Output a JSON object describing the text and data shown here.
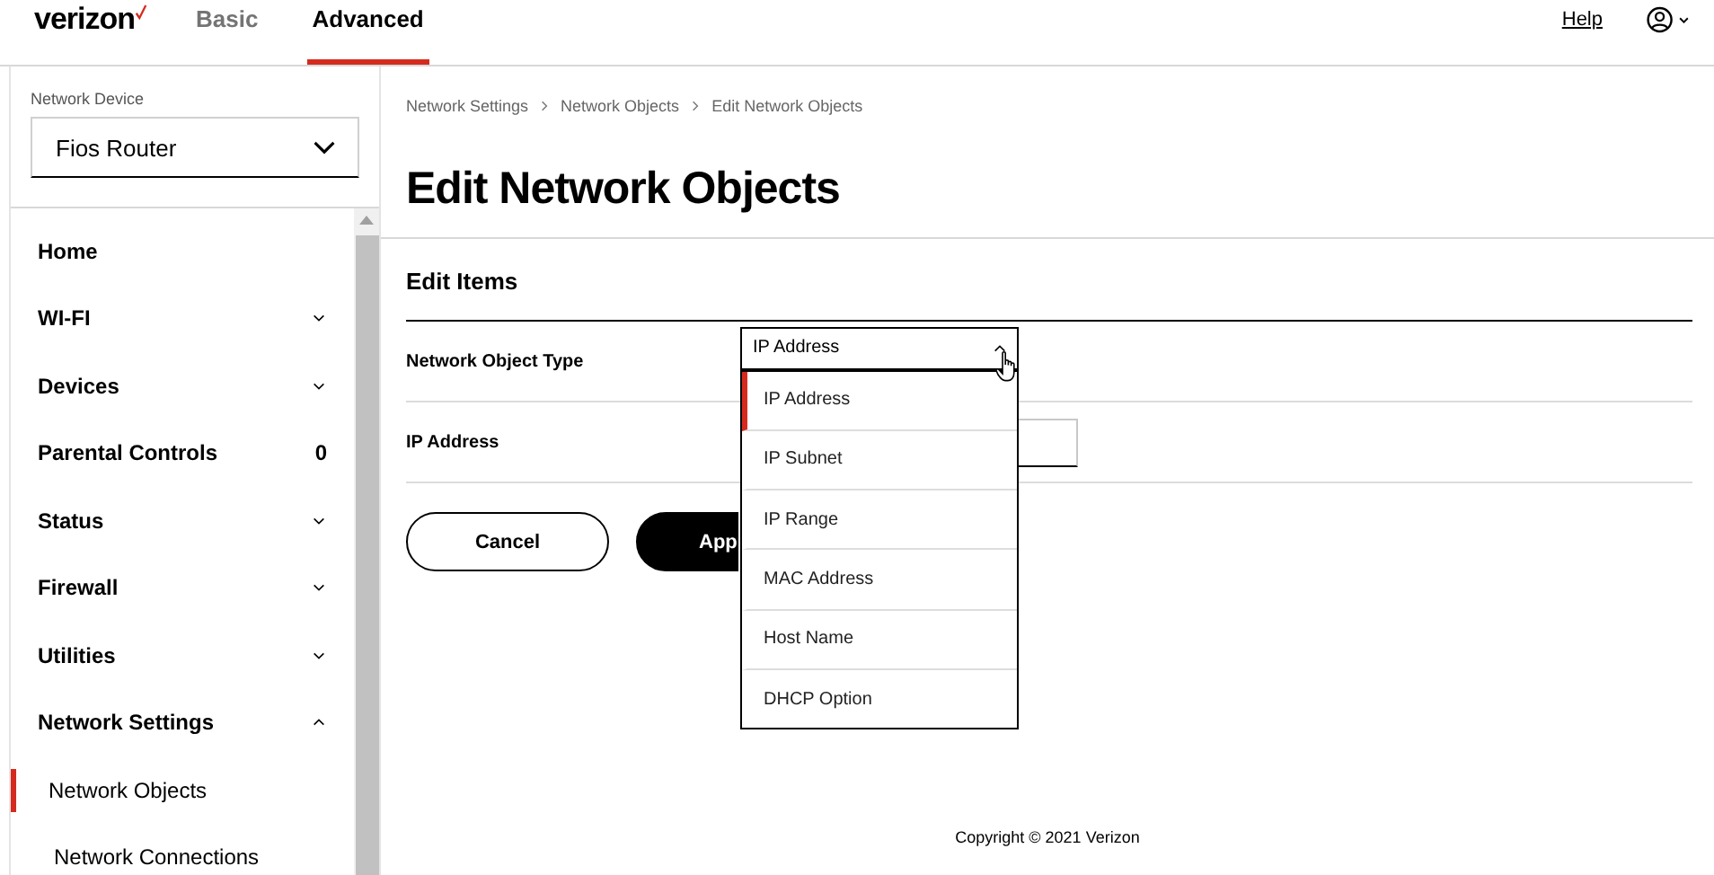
{
  "header": {
    "logo": "verizon",
    "tabs": [
      {
        "label": "Basic",
        "selected": false
      },
      {
        "label": "Advanced",
        "selected": true
      }
    ],
    "help": "Help"
  },
  "sidebar": {
    "device_label": "Network Device",
    "device_value": "Fios Router",
    "items": [
      {
        "label": "Home"
      },
      {
        "label": "WI-FI",
        "expanded": false
      },
      {
        "label": "Devices",
        "expanded": false
      },
      {
        "label": "Parental Controls",
        "badge": "0"
      },
      {
        "label": "Status",
        "expanded": false
      },
      {
        "label": "Firewall",
        "expanded": false
      },
      {
        "label": "Utilities",
        "expanded": false
      },
      {
        "label": "Network Settings",
        "expanded": true,
        "children": [
          {
            "label": "Network Objects",
            "selected": true
          },
          {
            "label": "Network Connections",
            "selected": false
          }
        ]
      }
    ]
  },
  "breadcrumb": [
    "Network Settings",
    "Network Objects",
    "Edit Network Objects"
  ],
  "title": "Edit Network Objects",
  "section": "Edit Items",
  "fields": [
    {
      "label": "Network Object Type",
      "kind": "select",
      "value": "IP Address",
      "expanded": true,
      "options": [
        {
          "label": "IP Address",
          "selected": true
        },
        {
          "label": "IP Subnet",
          "selected": false
        },
        {
          "label": "IP Range",
          "selected": false
        },
        {
          "label": "MAC Address",
          "selected": false
        },
        {
          "label": "Host Name",
          "selected": false
        },
        {
          "label": "DHCP Option",
          "selected": false
        }
      ]
    },
    {
      "label": "IP Address",
      "kind": "text"
    }
  ],
  "buttons": [
    {
      "label": "Cancel",
      "kind": "secondary"
    },
    {
      "label": "App",
      "kind": "primary"
    }
  ],
  "footer": "Copyright © 2021 Verizon"
}
